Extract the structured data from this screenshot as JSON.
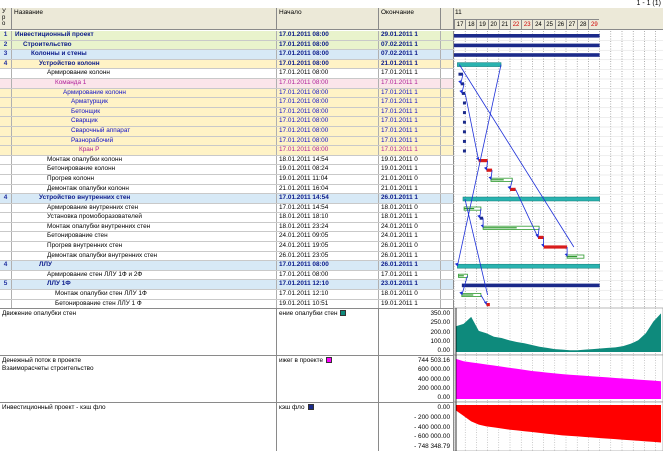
{
  "pager": "1 - 1 (1)",
  "header": {
    "idx": "У р о",
    "name": "Название",
    "start": "Начало",
    "end": "Окончание",
    "timeline_period": "11"
  },
  "timeline_days": [
    {
      "label": "17",
      "weekend": false
    },
    {
      "label": "18",
      "weekend": false
    },
    {
      "label": "19",
      "weekend": false
    },
    {
      "label": "20",
      "weekend": false
    },
    {
      "label": "21",
      "weekend": false
    },
    {
      "label": "22",
      "weekend": true
    },
    {
      "label": "23",
      "weekend": true
    },
    {
      "label": "24",
      "weekend": false
    },
    {
      "label": "25",
      "weekend": false
    },
    {
      "label": "26",
      "weekend": false
    },
    {
      "label": "27",
      "weekend": false
    },
    {
      "label": "28",
      "weekend": false
    },
    {
      "label": "29",
      "weekend": true
    }
  ],
  "colors": {
    "summary_bar": "#1b2a8a",
    "task_bar": "#2ab3b0",
    "critical_bar": "#d81b1b",
    "progress_bar": "#2e9a2e",
    "link": "#1d2fd8",
    "panel1_fill": "#0e8a7c",
    "panel2_fill": "#ff00ff",
    "panel3_fill": "#ff0000"
  },
  "rows": [
    {
      "idx": "1",
      "name": "Инвестиционный проект",
      "start": "17.01.2011 08:00",
      "end": "29.01.2011 1",
      "level": 0,
      "kind": "summary",
      "bg": "l1",
      "bar": {
        "type": "summary",
        "from": 0,
        "to": 13
      }
    },
    {
      "idx": "2",
      "name": "Строительство",
      "start": "17.01.2011 08:00",
      "end": "07.02.2011 1",
      "level": 1,
      "kind": "summary",
      "bg": "l1",
      "bar": {
        "type": "summary",
        "from": 0,
        "to": 13
      }
    },
    {
      "idx": "3",
      "name": "Колонны и стены",
      "start": "17.01.2011 08:00",
      "end": "07.02.2011 1",
      "level": 2,
      "kind": "summary",
      "bg": "l2",
      "bar": {
        "type": "summary",
        "from": 0,
        "to": 13
      }
    },
    {
      "idx": "4",
      "name": "Устройство колонн",
      "start": "17.01.2011 08:00",
      "end": "21.01.2011 1",
      "level": 3,
      "kind": "summary",
      "bg": "l3",
      "bar": {
        "type": "task",
        "from": 0.3,
        "to": 4.2
      }
    },
    {
      "idx": "",
      "name": "Армирование колонн",
      "start": "17.01.2011 08:00",
      "end": "17.01.2011 1",
      "level": 4,
      "kind": "task",
      "bg": "",
      "bar": {
        "type": "mark",
        "from": 0.4,
        "to": 0.8
      }
    },
    {
      "idx": "",
      "name": "Команда 1",
      "start": "17.01.2011 08:00",
      "end": "17.01.2011 1",
      "level": 5,
      "kind": "team",
      "bg": "team",
      "bar": {
        "type": "mark",
        "from": 0.6,
        "to": 0.9
      }
    },
    {
      "idx": "",
      "name": "Армирование колонн",
      "start": "17.01.2011 08:00",
      "end": "17.01.2011 1",
      "level": 6,
      "kind": "res",
      "bg": "l3",
      "bar": {
        "type": "mark",
        "from": 0.7,
        "to": 1.0
      }
    },
    {
      "idx": "",
      "name": "Арматурщик",
      "start": "17.01.2011 08:00",
      "end": "17.01.2011 1",
      "level": 7,
      "kind": "res",
      "bg": "l3",
      "bar": {
        "type": "mark",
        "from": 0.8,
        "to": 1.0
      }
    },
    {
      "idx": "",
      "name": "Бетонщик",
      "start": "17.01.2011 08:00",
      "end": "17.01.2011 1",
      "level": 7,
      "kind": "res",
      "bg": "l3",
      "bar": {
        "type": "mark",
        "from": 0.8,
        "to": 1.0
      }
    },
    {
      "idx": "",
      "name": "Сварщик",
      "start": "17.01.2011 08:00",
      "end": "17.01.2011 1",
      "level": 7,
      "kind": "res",
      "bg": "l3",
      "bar": {
        "type": "mark",
        "from": 0.8,
        "to": 1.0
      }
    },
    {
      "idx": "",
      "name": "Сварочный аппарат",
      "start": "17.01.2011 08:00",
      "end": "17.01.2011 1",
      "level": 7,
      "kind": "res",
      "bg": "l3",
      "bar": {
        "type": "mark",
        "from": 0.8,
        "to": 1.0
      }
    },
    {
      "idx": "",
      "name": "Разнорабочий",
      "start": "17.01.2011 08:00",
      "end": "17.01.2011 1",
      "level": 7,
      "kind": "res",
      "bg": "l3",
      "bar": {
        "type": "mark",
        "from": 0.8,
        "to": 1.0
      }
    },
    {
      "idx": "",
      "name": "Кран Р",
      "start": "17.01.2011 08:00",
      "end": "17.01.2011 1",
      "level": 8,
      "kind": "team",
      "bg": "l3",
      "bar": {
        "type": "mark",
        "from": 0.8,
        "to": 1.0
      }
    },
    {
      "idx": "",
      "name": "Монтаж опалубки колонн",
      "start": "18.01.2011 14:54",
      "end": "19.01.2011 0",
      "level": 4,
      "kind": "task",
      "bg": "",
      "bar": {
        "type": "critical",
        "from": 2.2,
        "to": 3.0
      }
    },
    {
      "idx": "",
      "name": "Бетонирование колонн",
      "start": "19.01.2011 08:24",
      "end": "19.01.2011 1",
      "level": 4,
      "kind": "task",
      "bg": "",
      "bar": {
        "type": "critical",
        "from": 2.9,
        "to": 3.4
      }
    },
    {
      "idx": "",
      "name": "Прогрев колонн",
      "start": "19.01.2011 11:04",
      "end": "21.01.2011 0",
      "level": 4,
      "kind": "task",
      "bg": "",
      "bar": {
        "type": "progress",
        "from": 3.3,
        "to": 5.2
      }
    },
    {
      "idx": "",
      "name": "Демонтаж опалубки колонн",
      "start": "21.01.2011 16:04",
      "end": "21.01.2011 1",
      "level": 4,
      "kind": "task",
      "bg": "",
      "bar": {
        "type": "critical",
        "from": 5.0,
        "to": 5.5
      }
    },
    {
      "idx": "4",
      "name": "Устройство внутренних стен",
      "start": "17.01.2011 14:54",
      "end": "26.01.2011 1",
      "level": 3,
      "kind": "summary",
      "bg": "l2",
      "bar": {
        "type": "task",
        "from": 0.8,
        "to": 13
      }
    },
    {
      "idx": "",
      "name": "Армирование внутренних стен",
      "start": "17.01.2011 14:54",
      "end": "18.01.2011 0",
      "level": 4,
      "kind": "task",
      "bg": "",
      "bar": {
        "type": "progress",
        "from": 0.9,
        "to": 2.4
      }
    },
    {
      "idx": "",
      "name": "Установка промоборазователей",
      "start": "18.01.2011 18:10",
      "end": "18.01.2011 1",
      "level": 4,
      "kind": "task",
      "bg": "",
      "bar": {
        "type": "mark",
        "from": 2.3,
        "to": 2.6
      }
    },
    {
      "idx": "",
      "name": "Монтаж опалубки внутренних стен",
      "start": "18.01.2011 23:24",
      "end": "24.01.2011 0",
      "level": 4,
      "kind": "task",
      "bg": "",
      "bar": {
        "type": "progress",
        "from": 2.6,
        "to": 7.6
      }
    },
    {
      "idx": "",
      "name": "Бетонирование стен",
      "start": "24.01.2011 09:05",
      "end": "24.01.2011 1",
      "level": 4,
      "kind": "task",
      "bg": "",
      "bar": {
        "type": "critical",
        "from": 7.5,
        "to": 8.0
      }
    },
    {
      "idx": "",
      "name": "Прогрев внутренних стен",
      "start": "24.01.2011 19:05",
      "end": "26.01.2011 0",
      "level": 4,
      "kind": "task",
      "bg": "",
      "bar": {
        "type": "critical",
        "from": 8.0,
        "to": 10.1
      }
    },
    {
      "idx": "",
      "name": "Демонтаж опалубки внутренних стен",
      "start": "26.01.2011 23:05",
      "end": "26.01.2011 1",
      "level": 4,
      "kind": "task",
      "bg": "",
      "bar": {
        "type": "progress",
        "from": 10.1,
        "to": 11.6
      }
    },
    {
      "idx": "4",
      "name": "ЛЛУ",
      "start": "17.01.2011 08:00",
      "end": "26.01.2011 1",
      "level": 3,
      "kind": "summary",
      "bg": "l2",
      "bar": {
        "type": "task",
        "from": 0.3,
        "to": 13
      }
    },
    {
      "idx": "",
      "name": "Армирование стен ЛЛУ 1Ф и 2Ф",
      "start": "17.01.2011 08:00",
      "end": "17.01.2011 1",
      "level": 4,
      "kind": "task",
      "bg": "",
      "bar": {
        "type": "progress",
        "from": 0.4,
        "to": 1.2
      }
    },
    {
      "idx": "5",
      "name": "ЛЛУ 1Ф",
      "start": "17.01.2011 12:10",
      "end": "23.01.2011 1",
      "level": 4,
      "kind": "summary",
      "bg": "l2",
      "bar": {
        "type": "summary",
        "from": 0.7,
        "to": 13
      }
    },
    {
      "idx": "",
      "name": "Монтаж опалубки стен ЛЛУ 1Ф",
      "start": "17.01.2011 12:10",
      "end": "18.01.2011 0",
      "level": 5,
      "kind": "task",
      "bg": "",
      "bar": {
        "type": "progress",
        "from": 0.7,
        "to": 2.4
      }
    },
    {
      "idx": "",
      "name": "Бетонирование стен ЛЛУ 1 Ф",
      "start": "19.01.2011 10:51",
      "end": "19.01.2011 1",
      "level": 5,
      "kind": "task",
      "bg": "",
      "bar": {
        "type": "critical",
        "from": 2.9,
        "to": 3.2
      }
    }
  ],
  "links": [
    [
      4,
      5
    ],
    [
      5,
      6
    ],
    [
      6,
      13
    ],
    [
      13,
      14
    ],
    [
      14,
      15
    ],
    [
      15,
      16
    ],
    [
      16,
      21
    ],
    [
      18,
      19
    ],
    [
      19,
      20
    ],
    [
      20,
      21
    ],
    [
      21,
      22
    ],
    [
      22,
      23
    ],
    [
      25,
      27
    ],
    [
      27,
      28
    ],
    [
      3,
      24
    ]
  ],
  "panels": [
    {
      "label": "Движение опалубки стен",
      "legend": "ение опалубки стен",
      "swatch": "#0e8a7c",
      "ticks": [
        "350.00",
        "250.00",
        "200.00",
        "100.00",
        "0.00"
      ],
      "values": [
        220,
        240,
        300,
        180,
        160,
        130,
        120,
        100,
        85,
        75,
        60,
        45,
        35,
        25,
        20,
        15,
        15,
        20,
        25,
        30,
        35,
        40,
        50,
        70,
        100,
        160,
        260,
        330
      ]
    },
    {
      "label": "Денежный поток в проекте",
      "label2": "Взаиморасчеты строительство",
      "legend": "ижег в проекте",
      "swatch": "#ff00ff",
      "ticks": [
        "744 503.16",
        "600 000.00",
        "400 000.00",
        "200 000.00",
        "0.00"
      ],
      "values": [
        744,
        700,
        680,
        660,
        640,
        620,
        600,
        580,
        560,
        540,
        520,
        505,
        490,
        475,
        460,
        450,
        440,
        430,
        420,
        410,
        400,
        390,
        380,
        370,
        360,
        350,
        340,
        330
      ]
    },
    {
      "label": "Инвестиционный проект - кэш фло",
      "legend": "кэш фло",
      "swatch": "#1b2a8a",
      "ticks": [
        "0.00",
        "- 200 000.00",
        "- 400 000.00",
        "- 600 000.00",
        "- 748 348.79"
      ],
      "values": [
        -100,
        -200,
        -300,
        -360,
        -390,
        -410,
        -430,
        -450,
        -465,
        -480,
        -495,
        -510,
        -525,
        -540,
        -555,
        -565,
        -575,
        -585,
        -595,
        -605,
        -615,
        -625,
        -635,
        -645,
        -655,
        -665,
        -675,
        -685
      ]
    }
  ]
}
